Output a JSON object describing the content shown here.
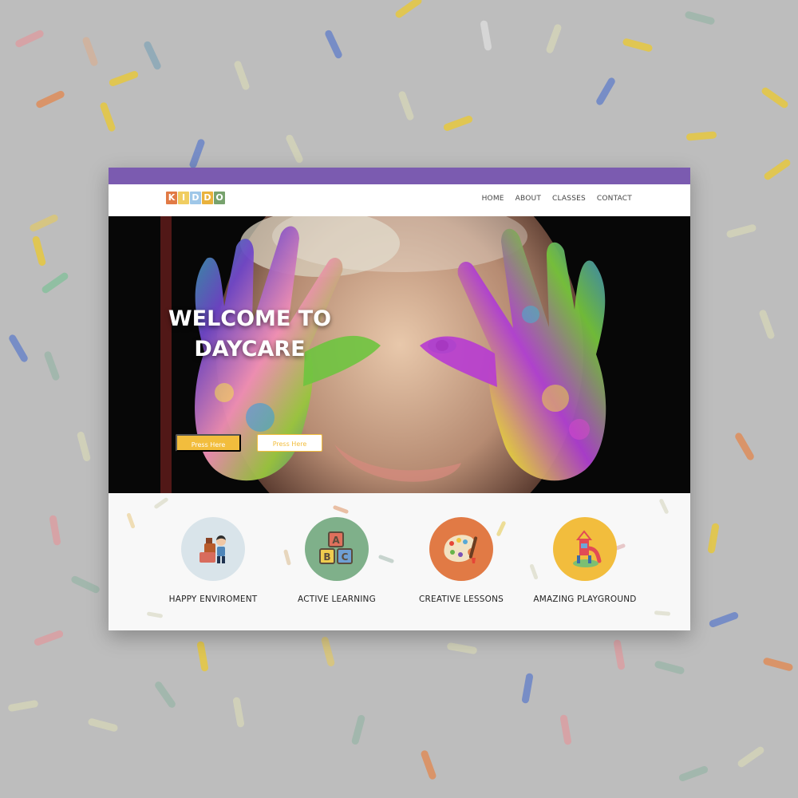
{
  "logo": {
    "letters": [
      "K",
      "I",
      "D",
      "D",
      "O"
    ]
  },
  "nav": [
    "HOME",
    "ABOUT",
    "CLASSES",
    "CONTACT"
  ],
  "hero": {
    "title_line1": "WELCOME TO",
    "title_line2": "DAYCARE",
    "button_primary": "Press Here",
    "button_secondary": "Press Here"
  },
  "features": [
    {
      "label": "HAPPY ENVIROMENT",
      "icon": "child-toys-icon"
    },
    {
      "label": "ACTIVE LEARNING",
      "icon": "abc-blocks-icon"
    },
    {
      "label": "CREATIVE LESSONS",
      "icon": "paint-palette-icon"
    },
    {
      "label": "AMAZING PLAYGROUND",
      "icon": "slide-icon"
    }
  ],
  "colors": {
    "purple": "#7b5bb0",
    "yellow": "#f2bd3d",
    "blue": "#6f87c7",
    "green": "#8bbf9f",
    "orange": "#e17a45",
    "soft_blue": "#d9e4ea"
  }
}
